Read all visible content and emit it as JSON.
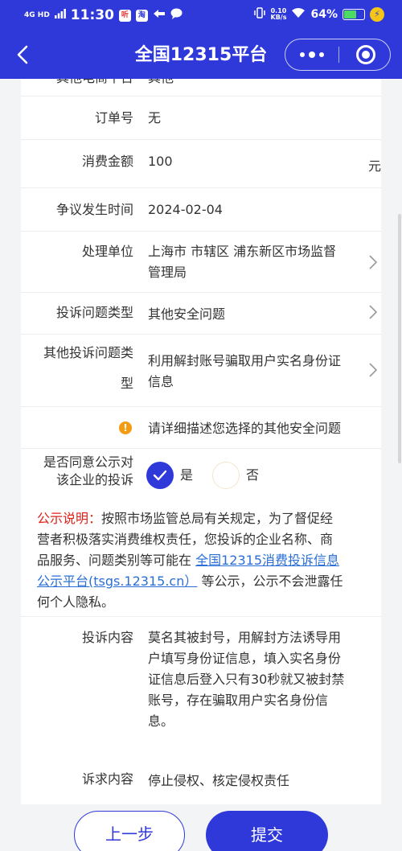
{
  "status_bar": {
    "network": "4G HD",
    "time": "11:30",
    "app_badge_1": "听",
    "app_badge_2": "淘",
    "speed_value": "0.10",
    "speed_unit": "KB/s",
    "battery_pct": "64%",
    "battery_level": 0.64,
    "icons": [
      "signal-icon",
      "nfc-icon",
      "message-icon",
      "vibrate-icon",
      "wifi-icon",
      "battery-icon",
      "charging-icon"
    ]
  },
  "nav": {
    "title": "全国12315平台",
    "back_icon": "chevron-left-icon",
    "more_icon": "more-dots-icon",
    "close_icon": "target-close-icon"
  },
  "form": {
    "cut_row": {
      "label": "其他电商平台",
      "value": "其他"
    },
    "order_no": {
      "label": "订单号",
      "value": "无"
    },
    "amount": {
      "label": "消费金额",
      "value": "100",
      "unit": "元"
    },
    "dispute_time": {
      "label": "争议发生时间",
      "value": "2024-02-04"
    },
    "handling_unit": {
      "label": "处理单位",
      "value_line1": "上海市 市辖区 浦东新区市场监督",
      "value_line2": "管理局"
    },
    "complaint_type": {
      "label": "投诉问题类型",
      "value": "其他安全问题"
    },
    "other_type": {
      "label_line1": "其他投诉问题类",
      "label_line2": "型",
      "value_line1": "利用解封账号骗取用户实名身份证",
      "value_line2": "信息"
    },
    "hint": {
      "text": "请详细描述您选择的其他安全问题"
    },
    "publicity": {
      "label_line1": "是否同意公示对",
      "label_line2": "该企业的投诉",
      "yes": "是",
      "no": "否",
      "selected": "是"
    },
    "notice": {
      "title": "公示说明：",
      "line1_rest": "按照市场监管总局有关规定，为了督促经",
      "line2": "营者积极落实消费维权责任，您投诉的企业名称、商",
      "line3_pre": "品服务、问题类别等可能在 ",
      "link_line1": "全国12315消费投诉信息",
      "link_line2": "公示平台(tsgs.12315.cn）",
      "line4_post": " 等公示，公示不会泄露任",
      "line5": "何个人隐私。"
    },
    "complaint_content": {
      "label": "投诉内容",
      "lines": [
        "莫名其被封号，用解封方法诱导用",
        "户填写身份证信息，填入实名身份",
        "证信息后登入只有30秒就又被封禁",
        "账号，存在骗取用户实名身份信",
        "息。"
      ]
    },
    "demand": {
      "label": "诉求内容",
      "value": "停止侵权、核定侵权责任"
    }
  },
  "footer": {
    "prev_label": "上一步",
    "submit_label": "提交"
  },
  "colors": {
    "brand": "#2f39d9",
    "notice_red": "#e0201a",
    "link_blue": "#2a6fd6",
    "warn_orange": "#f39c12"
  }
}
